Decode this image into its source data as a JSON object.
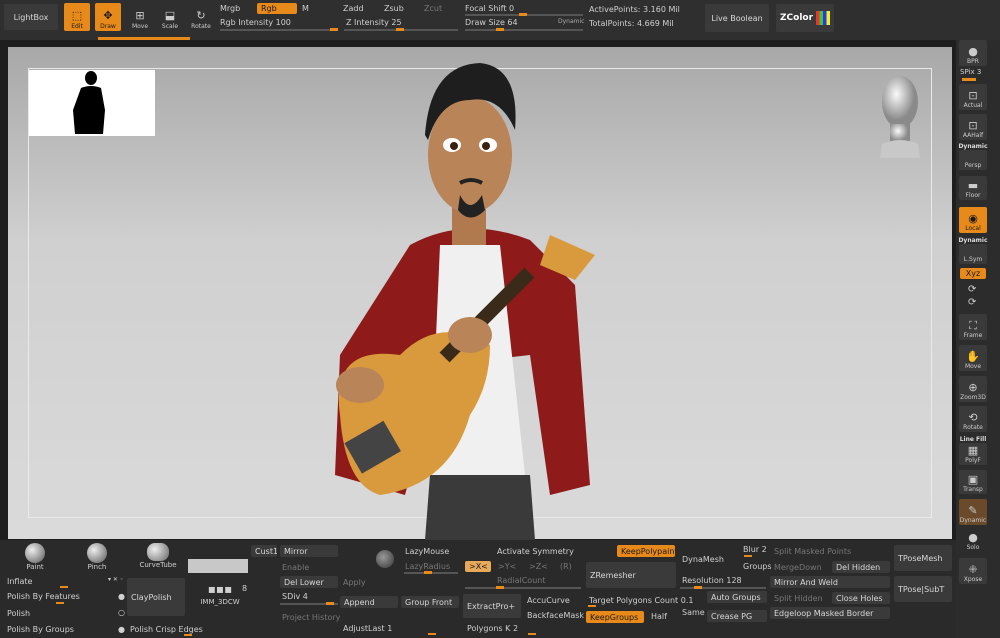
{
  "top": {
    "lightbox": "LightBox",
    "edit": "Edit",
    "draw": "Draw",
    "move": "Move",
    "scale": "Scale",
    "rotate": "Rotate",
    "mrgb": "Mrgb",
    "rgb": "Rgb",
    "m": "M",
    "rgb_intensity_label": "Rgb Intensity",
    "rgb_intensity": "100",
    "zadd": "Zadd",
    "zsub": "Zsub",
    "zcut": "Zcut",
    "z_intensity_label": "Z Intensity",
    "z_intensity": "25",
    "focal_shift_label": "Focal Shift",
    "focal_shift": "0",
    "draw_size_label": "Draw Size",
    "draw_size": "64",
    "dynamic": "Dynamic",
    "active_points_label": "ActivePoints:",
    "active_points": "3.160 Mil",
    "total_points_label": "TotalPoints:",
    "total_points": "4.669 Mil",
    "live_boolean": "Live Boolean",
    "zcolor": "ZColor"
  },
  "right": {
    "bpr": "BPR",
    "spix_label": "SPix",
    "spix": "3",
    "actual": "Actual",
    "aahalf": "AAHalf",
    "dynamic1": "Dynamic",
    "persp": "Persp",
    "floor": "Floor",
    "local": "Local",
    "dynamic2": "Dynamic",
    "lsym": "L.Sym",
    "xyz": "Xyz",
    "frame": "Frame",
    "move": "Move",
    "zoom3d": "Zoom3D",
    "rotate": "Rotate",
    "linefill": "Line Fill",
    "polyf": "PolyF",
    "transp": "Transp",
    "dynamic3": "Dynamic",
    "solo": "Solo",
    "xpose": "Xpose"
  },
  "brushes": {
    "paint": "Paint",
    "pinch": "Pinch",
    "curvetube": "CurveTube",
    "claypolish": "ClayPolish",
    "imm": "IMM_3DCW",
    "imm_count": "8",
    "inflate": "Inflate",
    "polish_features": "Polish By Features",
    "polish": "Polish",
    "polish_groups": "Polish By Groups",
    "polish_crisp": "Polish Crisp Edges"
  },
  "subtool": {
    "cust1": "Cust1",
    "mirror": "Mirror",
    "enable": "Enable",
    "del_lower": "Del Lower",
    "apply": "Apply",
    "sdiv_label": "SDiv",
    "sdiv": "4",
    "append": "Append",
    "project_history": "Project History",
    "group_front": "Group Front",
    "adjust_last_label": "AdjustLast",
    "adjust_last": "1",
    "lazymouse": "LazyMouse",
    "lazyradius": "LazyRadius",
    "activate_symmetry": "Activate Symmetry",
    "mx": ">X<",
    "my": ">Y<",
    "mz": ">Z<",
    "mr": "(R)",
    "radial_count": "RadialCount",
    "extractpro": "ExtractPro+",
    "accucurve": "AccuCurve",
    "backfacemask": "BackfaceMask",
    "polygons_k_label": "Polygons K",
    "polygons_k": "2"
  },
  "remesh": {
    "keeppolypaint": "KeepPolypaint",
    "zremesher": "ZRemesher",
    "target_label": "Target Polygons Count",
    "target": "0.1",
    "keepgroups": "KeepGroups",
    "half": "Half",
    "same": "Same",
    "dynamesh": "DynaMesh",
    "blur_label": "Blur",
    "blur": "2",
    "groups": "Groups",
    "resolution_label": "Resolution",
    "resolution": "128",
    "auto_groups": "Auto Groups",
    "crease_pg": "Crease PG",
    "split_masked": "Split Masked Points",
    "mergedown": "MergeDown",
    "del_hidden": "Del Hidden",
    "mirror_weld": "Mirror And Weld",
    "split_hidden": "Split Hidden",
    "close_holes": "Close Holes",
    "edgeloop": "Edgeloop Masked Border",
    "tposemesh": "TPoseMesh",
    "tpose_subt": "TPose|SubT"
  }
}
